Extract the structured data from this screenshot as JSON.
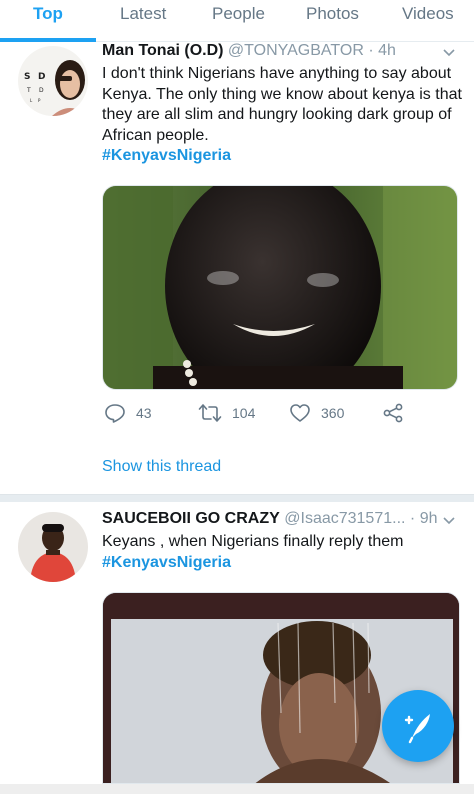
{
  "tabs": [
    "Top",
    "Latest",
    "People",
    "Photos",
    "Videos"
  ],
  "active_tab": "Top",
  "tweets": [
    {
      "name": "Man Tonai (O.D)",
      "handle": "@TONYAGBATOR",
      "time": "· 4h",
      "text": "I don't think Nigerians have anything to say about Kenya. The only thing we know about kenya is that they are all slim and hungry looking dark group of African people.",
      "hashtag": "#KenyavsNigeria",
      "replies": "43",
      "retweets": "104",
      "likes": "360",
      "show_thread": "Show this thread"
    },
    {
      "name": "SAUCEBOII GO CRAZY",
      "handle": "@Isaac731571...",
      "time": "· 9h",
      "text": "Keyans , when Nigerians finally reply them",
      "hashtag": "#KenyavsNigeria"
    }
  ],
  "avatar_1_letters": [
    [
      "S",
      "D"
    ],
    [
      "T",
      "D"
    ],
    [
      "L",
      "P"
    ]
  ],
  "colors": {
    "accent": "#1da1f2",
    "link": "#1b95e0",
    "secondary": "#657786"
  },
  "icons": [
    "reply-icon",
    "retweet-icon",
    "like-icon",
    "share-icon",
    "chevron-down-icon",
    "compose-tweet-icon"
  ]
}
